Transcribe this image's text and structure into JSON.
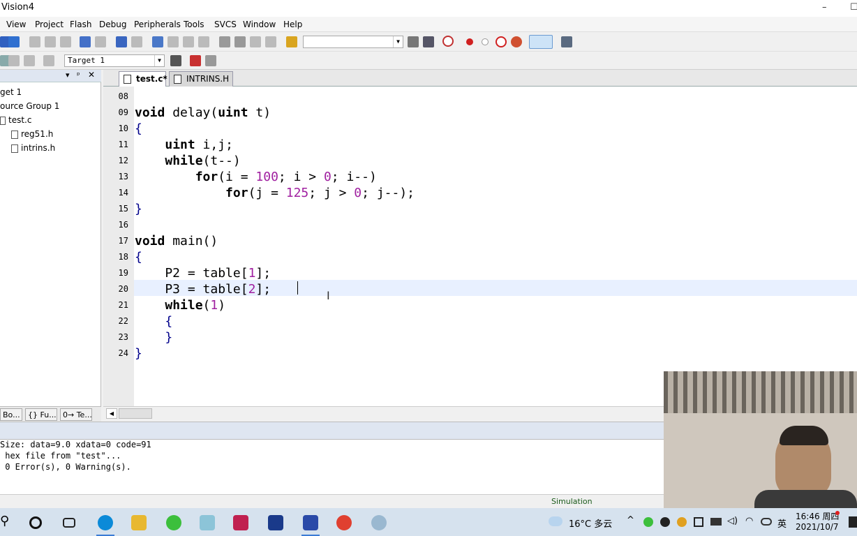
{
  "window": {
    "title": "Vision4",
    "minimize": "–",
    "maximize": "☐"
  },
  "menu": [
    "View",
    "Project",
    "Flash",
    "Debug",
    "Peripherals",
    "Tools",
    "SVCS",
    "Window",
    "Help"
  ],
  "toolbar": {
    "target_combo": "Target 1"
  },
  "project": {
    "root": "get 1",
    "group": "ource Group 1",
    "files": [
      "test.c",
      "reg51.h",
      "intrins.h"
    ]
  },
  "left_tabs": [
    "Bo...",
    "{} Fu...",
    "0→ Te..."
  ],
  "editor_tabs": [
    "test.c*",
    "INTRINS.H"
  ],
  "code": [
    {
      "n": "08",
      "t": ""
    },
    {
      "n": "09",
      "t": "void delay(uint t)"
    },
    {
      "n": "10",
      "t": "{"
    },
    {
      "n": "11",
      "t": "    uint i,j;"
    },
    {
      "n": "12",
      "t": "    while(t--)"
    },
    {
      "n": "13",
      "t": "        for(i = 100; i > 0; i--)"
    },
    {
      "n": "14",
      "t": "            for(j = 125; j > 0; j--);"
    },
    {
      "n": "15",
      "t": "}"
    },
    {
      "n": "16",
      "t": ""
    },
    {
      "n": "17",
      "t": "void main()"
    },
    {
      "n": "18",
      "t": "{"
    },
    {
      "n": "19",
      "t": "    P2 = table[1];"
    },
    {
      "n": "20",
      "t": "    P3 = table[2];"
    },
    {
      "n": "21",
      "t": "    while(1)"
    },
    {
      "n": "22",
      "t": "    {"
    },
    {
      "n": "23",
      "t": "    }"
    },
    {
      "n": "24",
      "t": "}"
    }
  ],
  "output": [
    "Size: data=9.0 xdata=0 code=91",
    " hex file from \"test\"...",
    " 0 Error(s), 0 Warning(s)."
  ],
  "status": {
    "mode": "Simulation"
  },
  "taskbar": {
    "weather": "16°C 多云",
    "ime": "英",
    "time": "16:46 周四",
    "date": "2021/10/7"
  }
}
